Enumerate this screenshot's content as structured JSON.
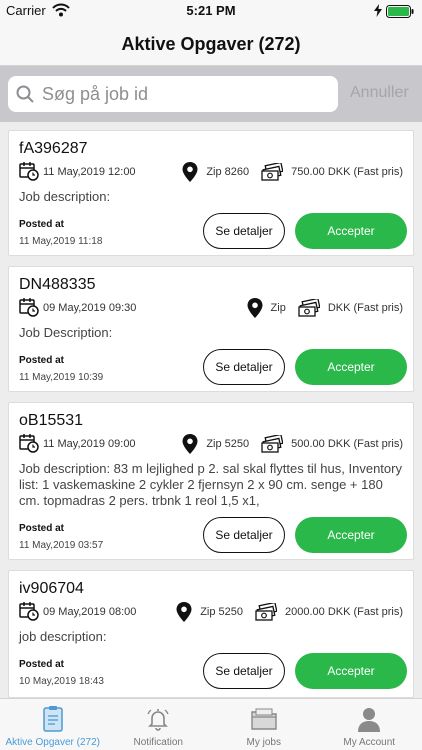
{
  "status_bar": {
    "carrier": "Carrier",
    "time": "5:21 PM"
  },
  "header": {
    "title": "Aktive Opgaver (272)"
  },
  "search": {
    "placeholder": "Søg på job id",
    "cancel_label": "Annuller"
  },
  "jobs": [
    {
      "id": "fA396287",
      "date": "11 May,2019 12:00",
      "zip": "Zip 8260",
      "price": "750.00 DKK (Fast pris)",
      "description": "Job description:",
      "posted_label": "Posted at",
      "posted_date": "11 May,2019 11:18",
      "detail_label": "Se detaljer",
      "accept_label": "Accepter"
    },
    {
      "id": "DN488335",
      "date": "09 May,2019 09:30",
      "zip": "Zip",
      "price": "DKK (Fast pris)",
      "description": "Job Description:",
      "posted_label": "Posted at",
      "posted_date": "11 May,2019 10:39",
      "detail_label": "Se detaljer",
      "accept_label": "Accepter"
    },
    {
      "id": "oB15531",
      "date": "11 May,2019 09:00",
      "zip": "Zip 5250",
      "price": "500.00 DKK (Fast pris)",
      "description": "Job description: 83 m lejlighed p 2. sal skal flyttes til hus, Inventory list: 1 vaskemaskine 2 cykler 2 fjernsyn 2 x 90 cm. senge + 180 cm. topmadras 2 pers. trbnk 1 reol 1,5 x1,",
      "posted_label": "Posted at",
      "posted_date": "11 May,2019 03:57",
      "detail_label": "Se detaljer",
      "accept_label": "Accepter"
    },
    {
      "id": "iv906704",
      "date": "09 May,2019 08:00",
      "zip": "Zip 5250",
      "price": "2000.00 DKK (Fast pris)",
      "description": "job description:",
      "posted_label": "Posted at",
      "posted_date": "10 May,2019 18:43",
      "detail_label": "Se detaljer",
      "accept_label": "Accepter"
    }
  ],
  "tabs": [
    {
      "label": "Aktive Opgaver (272)",
      "icon": "clipboard-icon",
      "active": true
    },
    {
      "label": "Notification",
      "icon": "bell-icon",
      "active": false
    },
    {
      "label": "My jobs",
      "icon": "folder-icon",
      "active": false
    },
    {
      "label": "My Account",
      "icon": "person-icon",
      "active": false
    }
  ],
  "colors": {
    "accent": "#2ab84a",
    "active_tab": "#4a9bd6",
    "background": "#ededed"
  }
}
